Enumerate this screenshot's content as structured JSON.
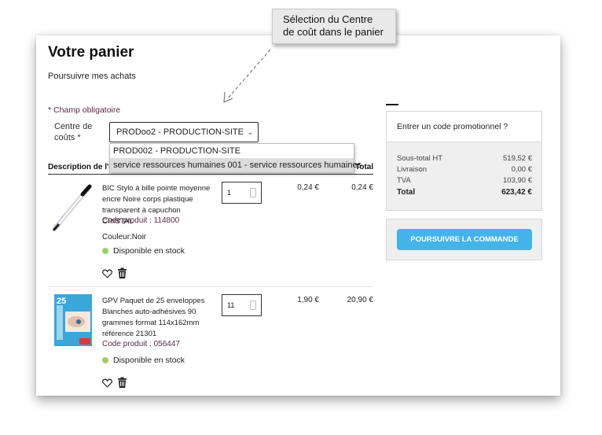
{
  "callout": {
    "text": "Sélection du Centre de coût dans le panier"
  },
  "cart": {
    "title": "Votre panier",
    "continue_link": "Poursuivre mes achats",
    "required_note": "* Champ obligatoire",
    "cost_center": {
      "label": "Centre de coûts",
      "required_mark": "*",
      "selected": "PRODoo2 - PRODUCTION-SITE",
      "options": [
        "PROD002 - PRODUCTION-SITE",
        "service ressources humaines 001 - service ressources humaines"
      ],
      "highlighted_index": 1
    },
    "table": {
      "col_desc": "Description de l'ar",
      "col_total": "Total"
    },
    "items": [
      {
        "name": "BIC Stylo à bille pointe moyenne encre Noire corps plastique transparent à capuchon CRISTAL",
        "code": "Code produit : 114800",
        "color": "Couleur:Noir",
        "stock": "Disponible en stock",
        "qty": "1",
        "unit_price": "0,24 €",
        "total": "0,24 €"
      },
      {
        "name": "GPV Paquet de 25 enveloppes Blanches auto-adhésives 90 grammes format 114x162mm référence 21301",
        "code": "Code produit : 056447",
        "stock": "Disponible en stock",
        "qty": "11",
        "unit_price": "1,90 €",
        "total": "20,90 €",
        "image_text": "25"
      }
    ]
  },
  "summary": {
    "promo_label": "Entrer un code promotionnel ?",
    "subtotal_label": "Sous-total HT",
    "subtotal_value": "519,52 €",
    "shipping_label": "Livraison",
    "shipping_value": "0,00 €",
    "vat_label": "TVA",
    "vat_value": "103,90 €",
    "total_label": "Total",
    "total_value": "623,42 €",
    "checkout_button": "POURSUIVRE LA COMMANDE"
  },
  "colors": {
    "accent": "#43b3ec",
    "plum": "#5a2a47",
    "stock_dot": "#9bd169"
  },
  "icons": [
    "heart-icon",
    "trash-icon",
    "chevron-down-icon",
    "spinner-icon",
    "arrow-icon"
  ]
}
